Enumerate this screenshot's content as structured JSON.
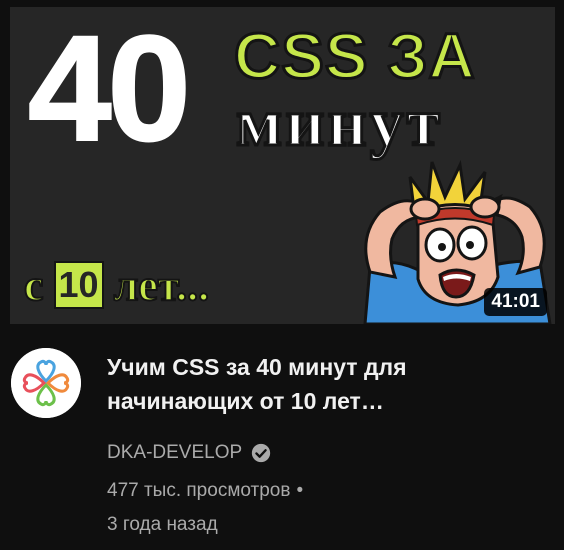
{
  "thumbnail": {
    "big_number": "40",
    "headline_top": "CSS ЗА",
    "headline_bottom": "минут",
    "bottom_prefix": "с",
    "bottom_number": "10",
    "bottom_suffix": "лет...",
    "duration": "41:01",
    "colors": {
      "background": "#262626",
      "accent_green": "#c5e64a",
      "text_white": "#ffffff"
    }
  },
  "video": {
    "title": "Учим CSS за 40 минут для начинающих от 10 лет…",
    "channel": "DKA-DEVELOP",
    "channel_verified_icon": "check-circle-icon",
    "views": "477 тыс. просмотров",
    "separator": "•",
    "age": "3 года назад"
  },
  "avatar": {
    "icon": "heart-clover-logo-icon"
  },
  "theme": {
    "page_background": "#0f0f0f",
    "title_color": "#f1f1f1",
    "meta_color": "#aaaaaa"
  }
}
